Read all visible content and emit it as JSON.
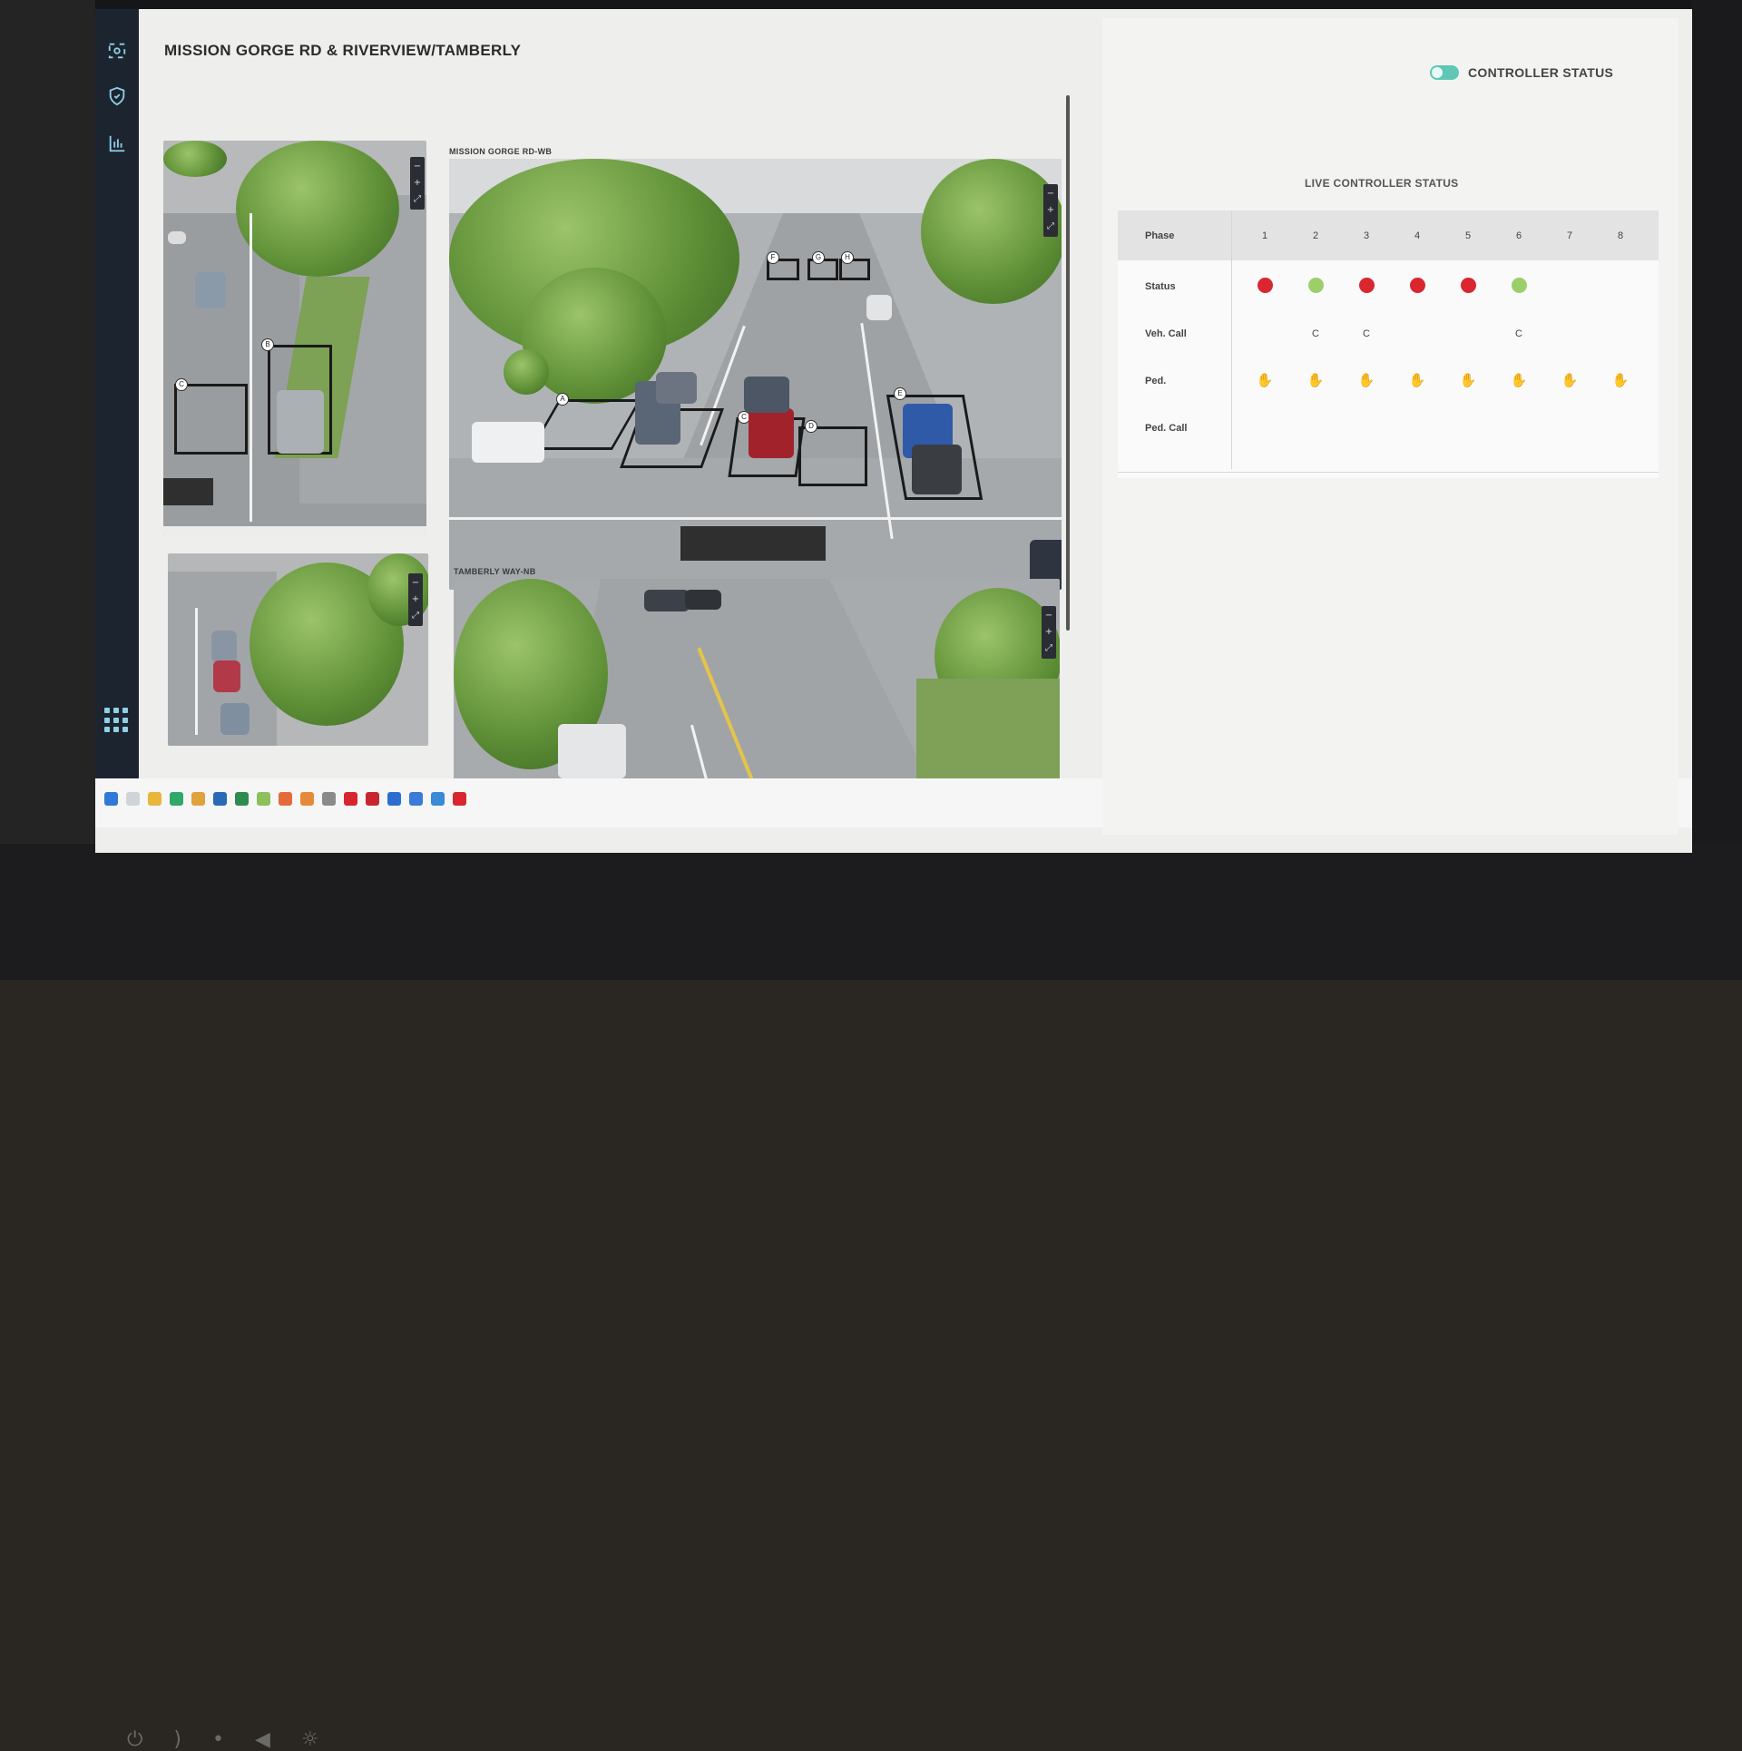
{
  "screen": {
    "title": "MISSION GORGE RD & RIVERVIEW/TAMBERLY"
  },
  "nav": {
    "items": [
      {
        "icon": "camera-link-icon",
        "glyph": "(o)"
      },
      {
        "icon": "shield-icon"
      },
      {
        "icon": "chart-icon"
      }
    ],
    "apps_icon": "grid-icon"
  },
  "cameras": {
    "top_right_label": "MISSION GORGE RD-WB",
    "bottom_right_label": "TAMBERLY WAY-NB",
    "zone_tags": [
      "A",
      "B",
      "C",
      "D",
      "E",
      "F",
      "G",
      "H"
    ],
    "controls": [
      "−",
      "+",
      "⤢"
    ]
  },
  "panel": {
    "controller_status_label": "CONTROLLER STATUS",
    "controller_status_on": true,
    "live_title": "LIVE CONTROLLER STATUS",
    "row_headers": [
      "Phase",
      "Status",
      "Veh. Call",
      "Ped.",
      "Ped. Call"
    ],
    "phases": [
      "1",
      "2",
      "3",
      "4",
      "5",
      "6",
      "7",
      "8"
    ],
    "status": [
      "red",
      "green",
      "red",
      "red",
      "red",
      "green",
      "",
      ""
    ],
    "veh_call": [
      "",
      "C",
      "C",
      "",
      "",
      "C",
      "",
      ""
    ],
    "ped": [
      "hand",
      "hand",
      "hand",
      "hand",
      "hand",
      "hand",
      "hand",
      "hand"
    ],
    "ped_call": [
      "",
      "",
      "",
      "",
      "",
      "",
      "",
      ""
    ]
  },
  "colors": {
    "red": "#d9262f",
    "green": "#9ccf6a",
    "toggle": "#5fc7b4",
    "nav_bg": "#1c2430"
  },
  "taskbar": {
    "icons": [
      "windows-icon",
      "search-icon",
      "folder-icon",
      "edge-icon",
      "chrome-icon",
      "outlook-icon",
      "excel-icon",
      "file-icon",
      "warning-icon",
      "warning-icon",
      "tool-icon",
      "app-icon",
      "app-icon",
      "app-icon",
      "app-icon",
      "app-icon",
      "app-icon"
    ]
  }
}
